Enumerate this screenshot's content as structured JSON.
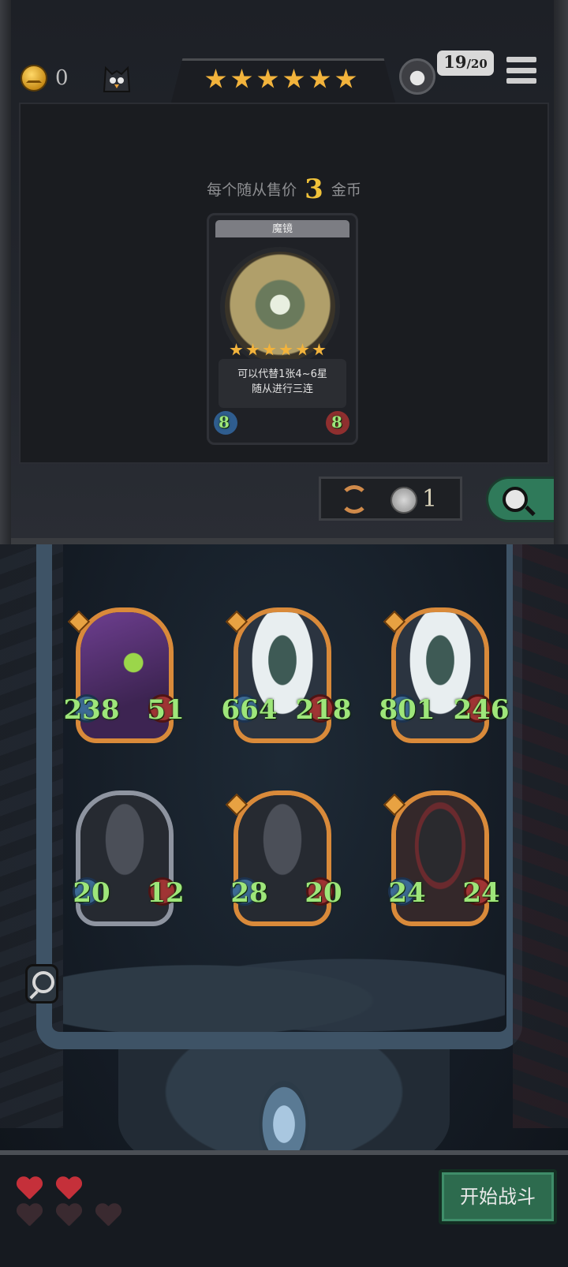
{
  "header": {
    "coins": "0",
    "star_count": 6,
    "turn": "19",
    "turn_max": "/20"
  },
  "shop": {
    "price_prefix": "每个随从售价",
    "price_value": "3",
    "price_suffix": "金币",
    "card": {
      "name": "魔镜",
      "stars": 6,
      "desc_line1": "可以代替1张4~6星",
      "desc_line2": "随从进行三连",
      "attack": "8",
      "health": "8"
    },
    "refresh_cost": "1"
  },
  "board": {
    "minions": [
      {
        "attack": "238",
        "health": "51",
        "frame": "gold",
        "art": "purple-wolf"
      },
      {
        "attack": "664",
        "health": "218",
        "frame": "gold",
        "art": "white-mane-werewolf"
      },
      {
        "attack": "801",
        "health": "246",
        "frame": "gold",
        "art": "white-mane-werewolf"
      },
      {
        "attack": "20",
        "health": "12",
        "frame": "silver",
        "art": "gray-werewolf"
      },
      {
        "attack": "28",
        "health": "20",
        "frame": "gold",
        "art": "gray-werewolf"
      },
      {
        "attack": "24",
        "health": "24",
        "frame": "gold",
        "art": "red-eared-wolf"
      }
    ]
  },
  "footer": {
    "lives_full": 2,
    "lives_empty": 3,
    "start_label": "开始战斗"
  },
  "colors": {
    "accent_gold": "#f2b33c",
    "stat_green": "#9ee67a",
    "start_button": "#2d6b4e",
    "heart_full": "#c5303a",
    "heart_empty": "#3a2a30"
  }
}
